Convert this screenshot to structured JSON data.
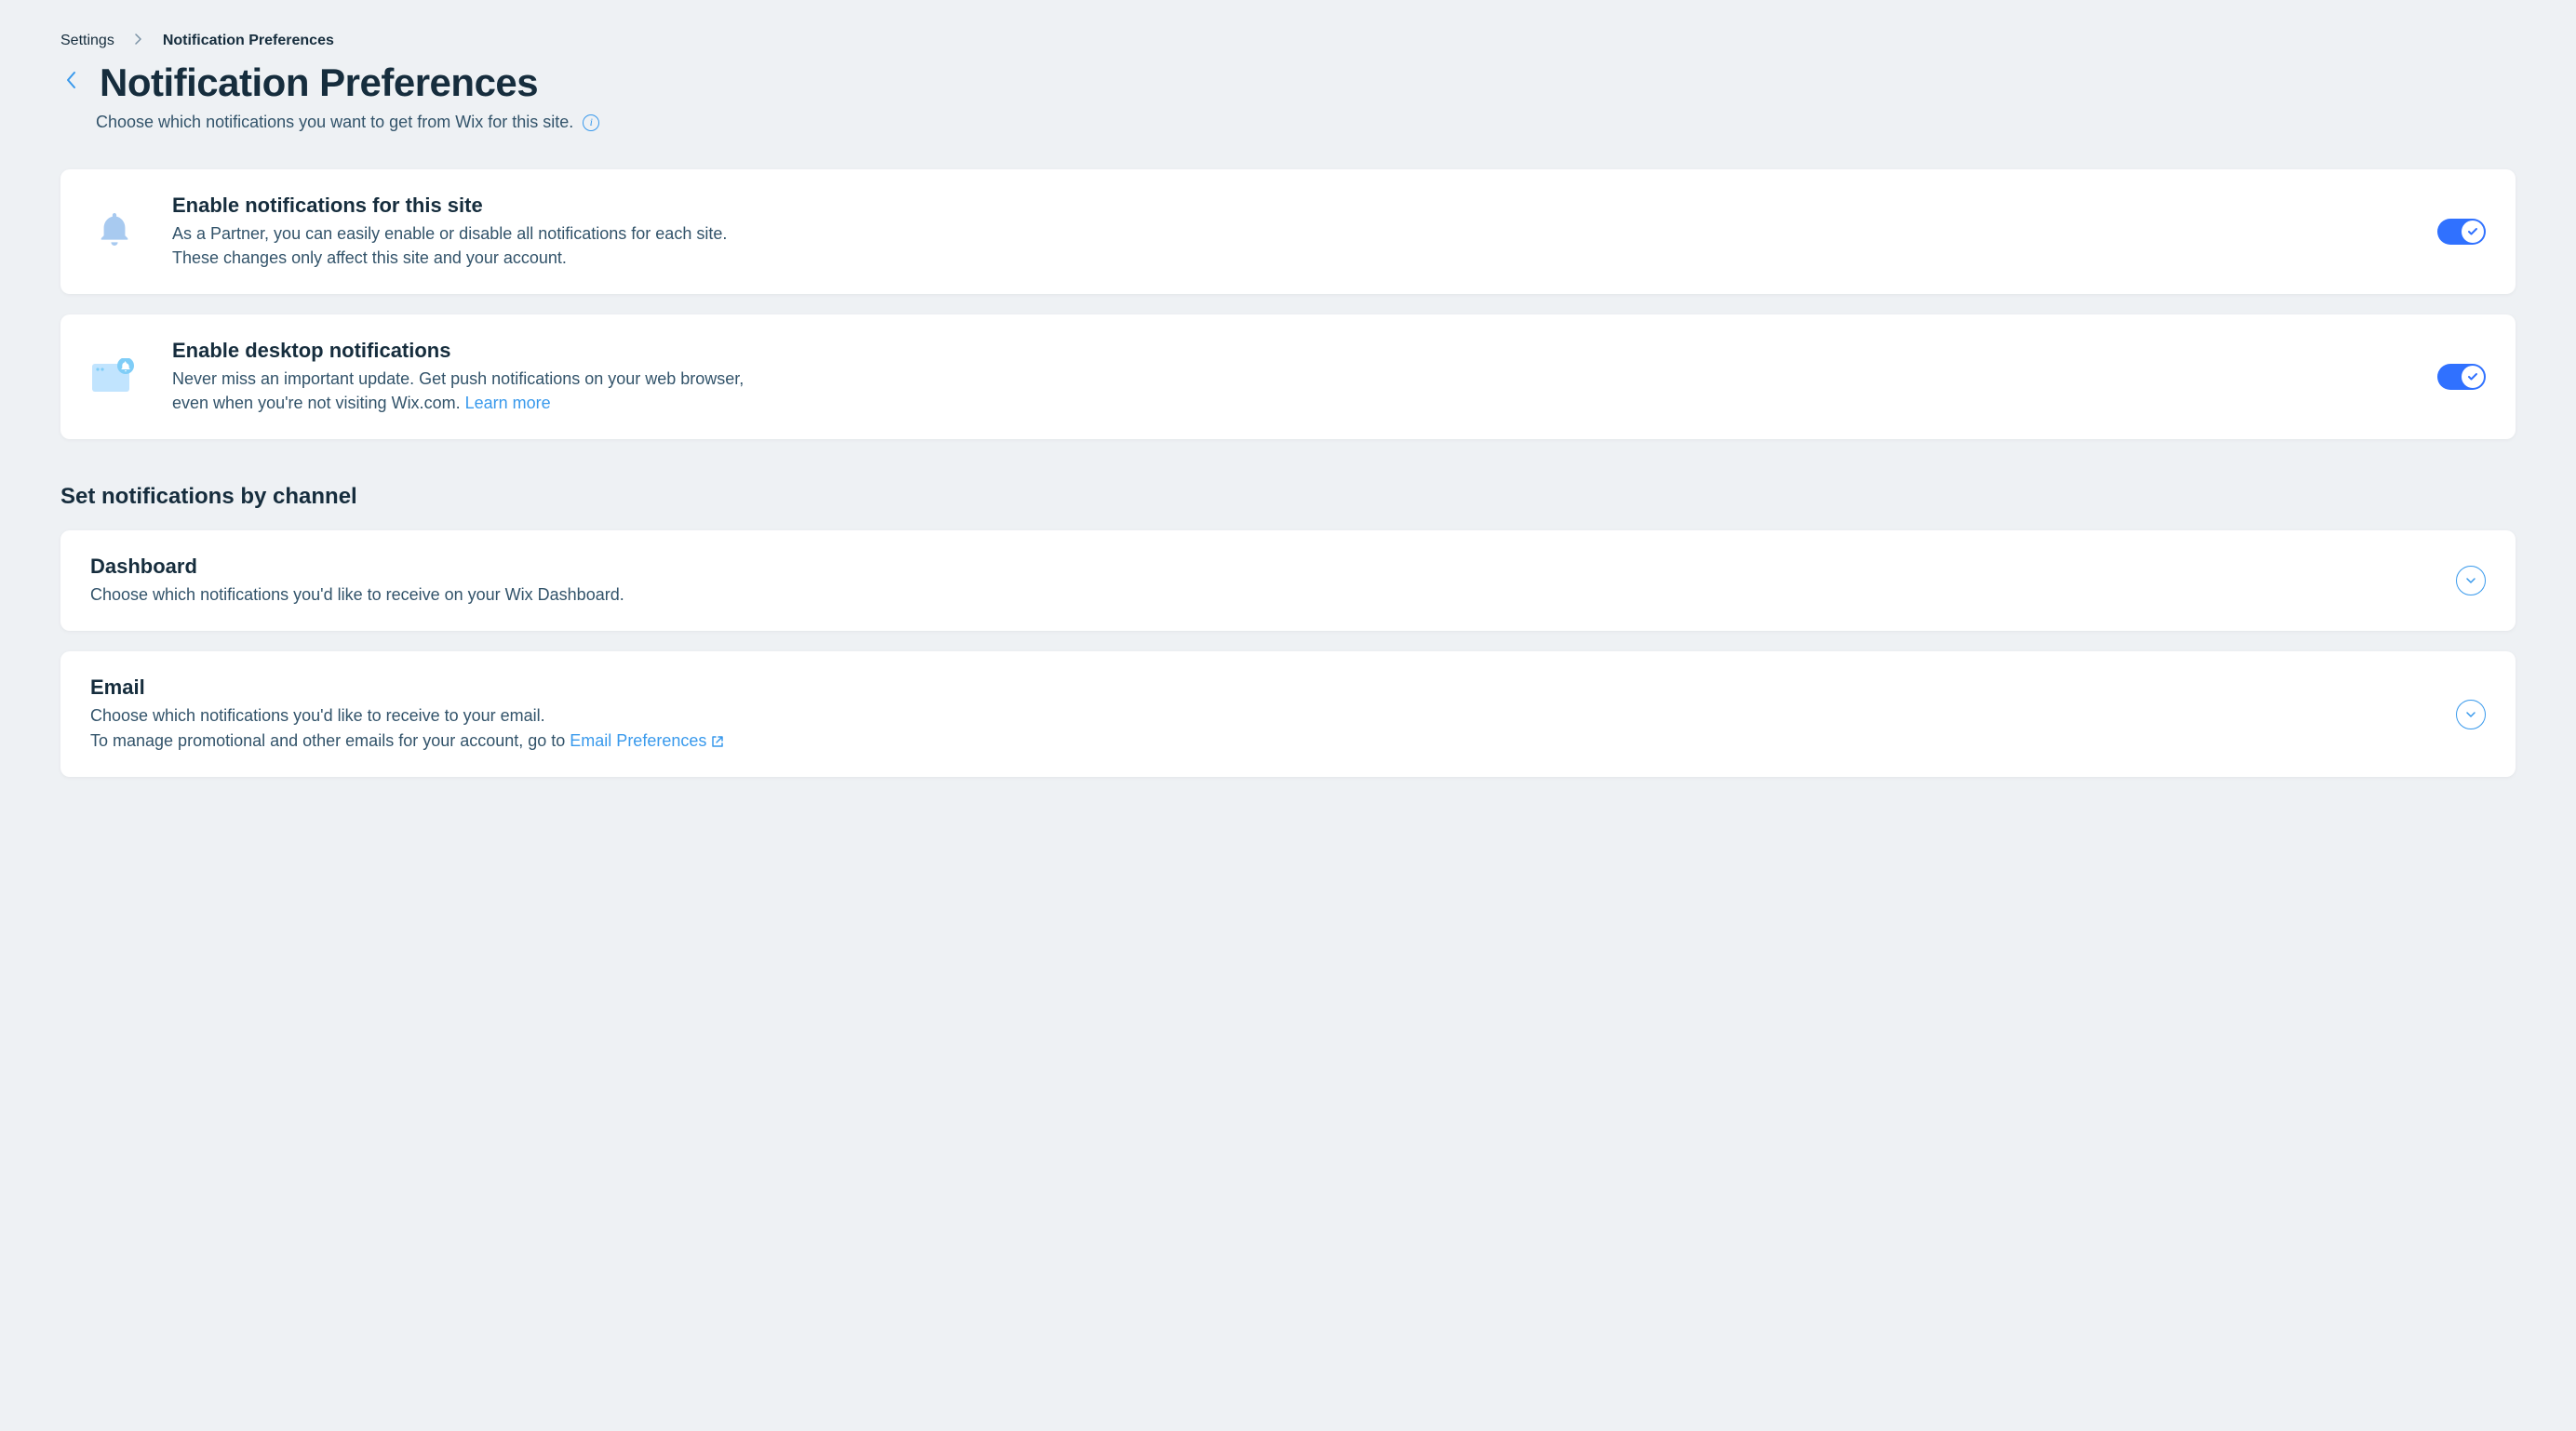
{
  "breadcrumb": {
    "root": "Settings",
    "current": "Notification Preferences"
  },
  "page": {
    "title": "Notification Preferences",
    "subtitle": "Choose which notifications you want to get from Wix for this site."
  },
  "enableSite": {
    "title": "Enable notifications for this site",
    "desc_line1": "As a Partner, you can easily enable or disable all notifications for each site.",
    "desc_line2": "These changes only affect this site and your account."
  },
  "enableDesktop": {
    "title": "Enable desktop notifications",
    "desc_line1": "Never miss an important update. Get push notifications on your web browser,",
    "desc_line2_prefix": "even when you're not visiting Wix.com. ",
    "learn_more": "Learn more"
  },
  "section": {
    "heading": "Set notifications by channel"
  },
  "channels": {
    "dashboard": {
      "title": "Dashboard",
      "desc": "Choose which notifications you'd like to receive on your Wix Dashboard."
    },
    "email": {
      "title": "Email",
      "desc_line1": "Choose which notifications you'd like to receive to your email.",
      "desc_line2_prefix": "To manage promotional and other emails for your account, go to ",
      "link": "Email Preferences"
    }
  }
}
